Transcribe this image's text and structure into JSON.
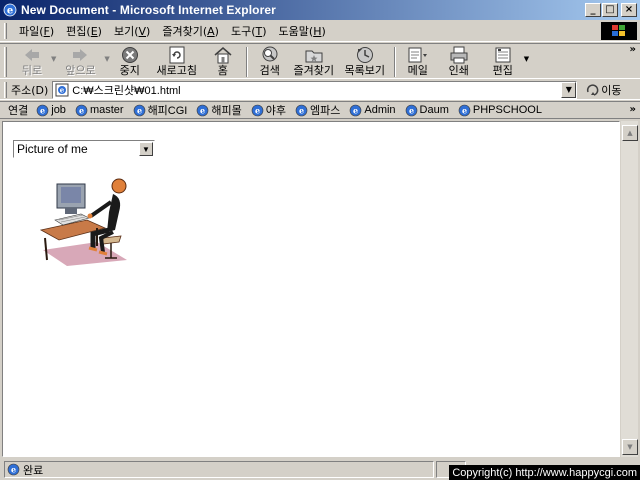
{
  "window": {
    "title": "New Document - Microsoft Internet Explorer",
    "minimize": "_",
    "maximize": "□",
    "close": "×"
  },
  "menu": {
    "items": [
      {
        "label": "파일(",
        "key": "F",
        "end": ")"
      },
      {
        "label": "편집(",
        "key": "E",
        "end": ")"
      },
      {
        "label": "보기(",
        "key": "V",
        "end": ")"
      },
      {
        "label": "즐겨찾기(",
        "key": "A",
        "end": ")"
      },
      {
        "label": "도구(",
        "key": "T",
        "end": ")"
      },
      {
        "label": "도움말(",
        "key": "H",
        "end": ")"
      }
    ]
  },
  "toolbar": {
    "back": "뒤로",
    "forward": "앞으로",
    "stop": "중지",
    "refresh": "새로고침",
    "home": "홈",
    "search": "검색",
    "favorites": "즐겨찾기",
    "history": "목록보기",
    "mail": "메일",
    "print": "인쇄",
    "edit": "편집",
    "more": "»"
  },
  "address": {
    "label": "주소(D)",
    "url": "C:₩스크린샷₩01.html",
    "go": "이동"
  },
  "links": {
    "label": "연결",
    "items": [
      "job",
      "master",
      "해피CGI",
      "해피몰",
      "야후",
      "엠파스",
      "Admin",
      "Daum",
      "PHPSCHOOL"
    ],
    "more": "»"
  },
  "content": {
    "select_value": "Picture of me"
  },
  "status": {
    "text": "완료",
    "copyright": "Copyright(c) http://www.happycgi.com"
  },
  "colors": {
    "titlebar_start": "#0a246a",
    "titlebar_end": "#a6caf0",
    "chrome": "#d4d0c8"
  }
}
